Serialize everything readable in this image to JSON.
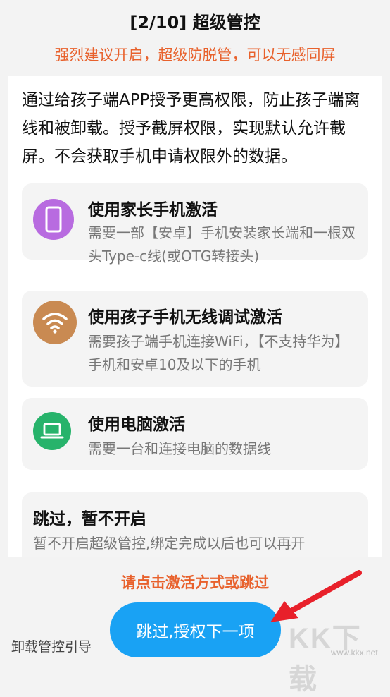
{
  "header": {
    "title": "[2/10] 超级管控",
    "subtitle": "强烈建议开启，超级防脱管，可以无感同屏"
  },
  "description": "通过给孩子端APP授予更高权限，防止孩子端离线和被卸载。授予截屏权限，实现默认允许截屏。不会获取手机申请权限外的数据。",
  "options": [
    {
      "title": "使用家长手机激活",
      "desc": "需要一部【安卓】手机安装家长端和一根双头Type-c线(或OTG转接头)",
      "icon": "phone-icon",
      "color": "#b86be0"
    },
    {
      "title": "使用孩子手机无线调试激活",
      "desc": "需要孩子端手机连接WiFi，【不支持华为】手机和安卓10及以下的手机",
      "icon": "wifi-icon",
      "color": "#c98a52"
    },
    {
      "title": "使用电脑激活",
      "desc": "需要一台和连接电脑的数据线",
      "icon": "laptop-icon",
      "color": "#27b36b"
    }
  ],
  "skip": {
    "title": "跳过，暂不开启",
    "desc": "暂不开启超级管控,绑定完成以后也可以再开"
  },
  "footer": {
    "prompt": "请点击激活方式或跳过",
    "next_button": "跳过,授权下一项",
    "uninstall_link": "卸载管控引导"
  },
  "watermark": {
    "text": "KK下载",
    "url": "www.kkx.net"
  }
}
